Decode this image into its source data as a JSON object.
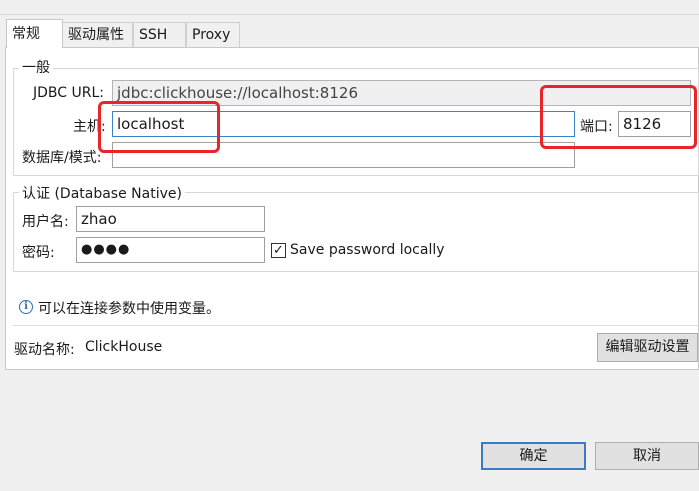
{
  "tabs": [
    {
      "label": "常规",
      "active": true
    },
    {
      "label": "驱动属性",
      "active": false
    },
    {
      "label": "SSH",
      "active": false
    },
    {
      "label": "Proxy",
      "active": false
    }
  ],
  "general": {
    "legend": "一般",
    "jdbc_label": "JDBC URL:",
    "jdbc_value": "jdbc:clickhouse://localhost:8126",
    "host_label": "主机:",
    "host_value": "localhost",
    "port_label": "端口:",
    "port_value": "8126",
    "db_label": "数据库/模式:",
    "db_value": ""
  },
  "auth": {
    "legend": "认证 (Database Native)",
    "user_label": "用户名:",
    "user_value": "zhao",
    "password_label": "密码:",
    "password_value": "●●●●",
    "save_password_label": "Save password locally",
    "save_password_checked": "✓"
  },
  "info": {
    "icon": "info-icon",
    "text": "可以在连接参数中使用变量。"
  },
  "driver": {
    "label": "驱动名称:",
    "value": "ClickHouse",
    "edit_button": "编辑驱动设置"
  },
  "footer": {
    "ok_button": "确定",
    "cancel_button": "取消"
  },
  "colors": {
    "highlight": "#e8262a",
    "focus_border": "#3a83c6",
    "primary_button_border": "#3d7ac4"
  }
}
